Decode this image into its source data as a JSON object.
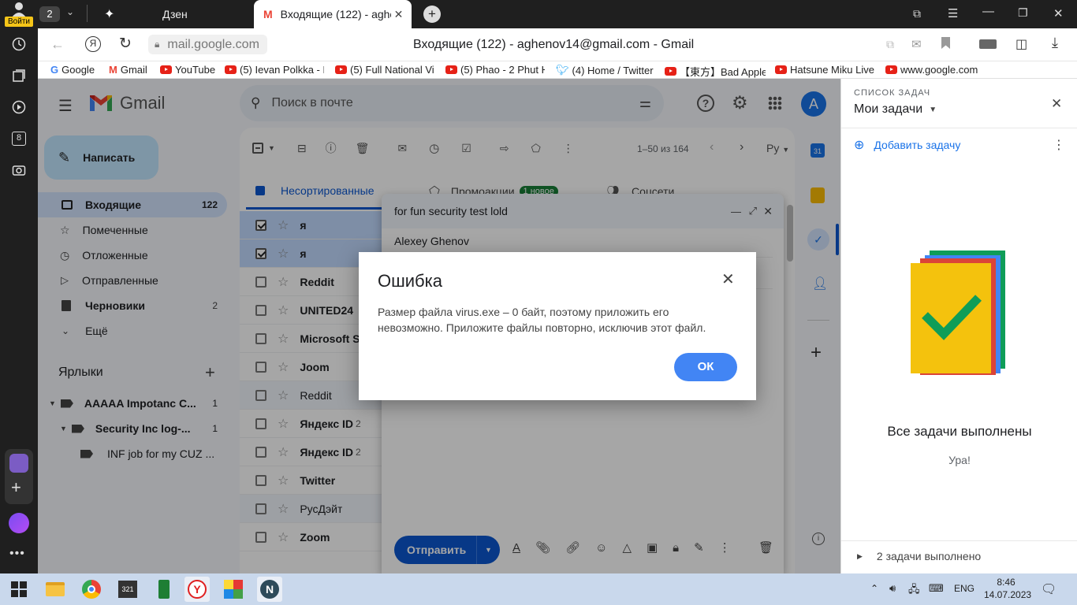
{
  "browser": {
    "login_label": "Войти",
    "tab_count": "2",
    "tabs": [
      {
        "label": "Дзен"
      },
      {
        "label": "Входящие (122) - aghen"
      }
    ],
    "url": "mail.google.com",
    "page_title": "Входящие (122) - aghenov14@gmail.com - Gmail",
    "sidebar_badge": "8",
    "bookmarks": [
      {
        "label": "Google",
        "icon": "google-icon"
      },
      {
        "label": "Gmail",
        "icon": "gmail-icon"
      },
      {
        "label": "YouTube",
        "icon": "youtube-icon"
      },
      {
        "label": "(5) Ievan Polkka - H",
        "icon": "youtube-icon"
      },
      {
        "label": "(5) Full National Vi",
        "icon": "youtube-icon"
      },
      {
        "label": "(5) Phao - 2 Phut H",
        "icon": "youtube-icon"
      },
      {
        "label": "(4) Home / Twitter",
        "icon": "twitter-icon"
      },
      {
        "label": "【東方】Bad Apple!!",
        "icon": "youtube-icon"
      },
      {
        "label": "Hatsune Miku Live",
        "icon": "youtube-icon"
      },
      {
        "label": "www.google.com",
        "icon": "youtube-icon"
      }
    ]
  },
  "gmail": {
    "logo_text": "Gmail",
    "search_placeholder": "Поиск в почте",
    "avatar_letter": "A",
    "compose_label": "Написать",
    "nav": [
      {
        "label": "Входящие",
        "count": "122",
        "icon": "inbox-icon",
        "bold": true,
        "active": true
      },
      {
        "label": "Помеченные",
        "count": "",
        "icon": "star-icon"
      },
      {
        "label": "Отложенные",
        "count": "",
        "icon": "clock-icon"
      },
      {
        "label": "Отправленные",
        "count": "",
        "icon": "send-icon"
      },
      {
        "label": "Черновики",
        "count": "2",
        "icon": "draft-icon",
        "bold": true
      },
      {
        "label": "Ещё",
        "count": "",
        "icon": "chevron-down-icon"
      }
    ],
    "labels_title": "Ярлыки",
    "labels": [
      {
        "label": "AAAAA Impotanc C...",
        "count": "1"
      },
      {
        "label": "Security Inc log-...",
        "count": "1"
      },
      {
        "label": "INF job for my CUZ ...",
        "count": ""
      }
    ],
    "pagination": "1–50 из 164",
    "lang_btn": "Ру",
    "tabs": [
      {
        "label": "Несортированные"
      },
      {
        "label": "Промоакции",
        "badge": "1 новое"
      },
      {
        "label": "Соцсети"
      }
    ],
    "emails": [
      {
        "sender": "я",
        "count": "",
        "selected": true,
        "bold": true
      },
      {
        "sender": "я",
        "count": "",
        "selected": true,
        "bold": true
      },
      {
        "sender": "Reddit",
        "count": "",
        "bold": true
      },
      {
        "sender": "UNITED24",
        "count": "",
        "bold": true
      },
      {
        "sender": "Microsoft S",
        "count": "",
        "bold": true
      },
      {
        "sender": "Joom",
        "count": "",
        "bold": true
      },
      {
        "sender": "Reddit",
        "count": ""
      },
      {
        "sender": "Яндекс ID",
        "count": "2",
        "bold": true
      },
      {
        "sender": "Яндекс ID",
        "count": "2",
        "bold": true
      },
      {
        "sender": "Twitter",
        "count": "",
        "bold": true
      },
      {
        "sender": "РусДэйт",
        "count": ""
      },
      {
        "sender": "Zoom",
        "count": "",
        "bold": true
      }
    ]
  },
  "compose": {
    "subject": "for fun security test lold",
    "to": "Alexey Ghenov",
    "send_label": "Отправить"
  },
  "dialog": {
    "title": "Ошибка",
    "message": "Размер файла virus.exe – 0 байт, поэтому приложить его невозможно. Приложите файлы повторно, исключив этот файл.",
    "ok_label": "ОК"
  },
  "tasks": {
    "header": "СПИСОК ЗАДАЧ",
    "list_name": "Мои задачи",
    "add_label": "Добавить задачу",
    "done_title": "Все задачи выполнены",
    "done_sub": "Ура!",
    "completed": "2 задачи выполнено"
  },
  "taskbar": {
    "lang": "ENG",
    "time": "8:46",
    "date": "14.07.2023"
  },
  "colors": {
    "accent": "#0b57d0",
    "ok_button": "#4285f4",
    "promo_badge": "#188038"
  }
}
